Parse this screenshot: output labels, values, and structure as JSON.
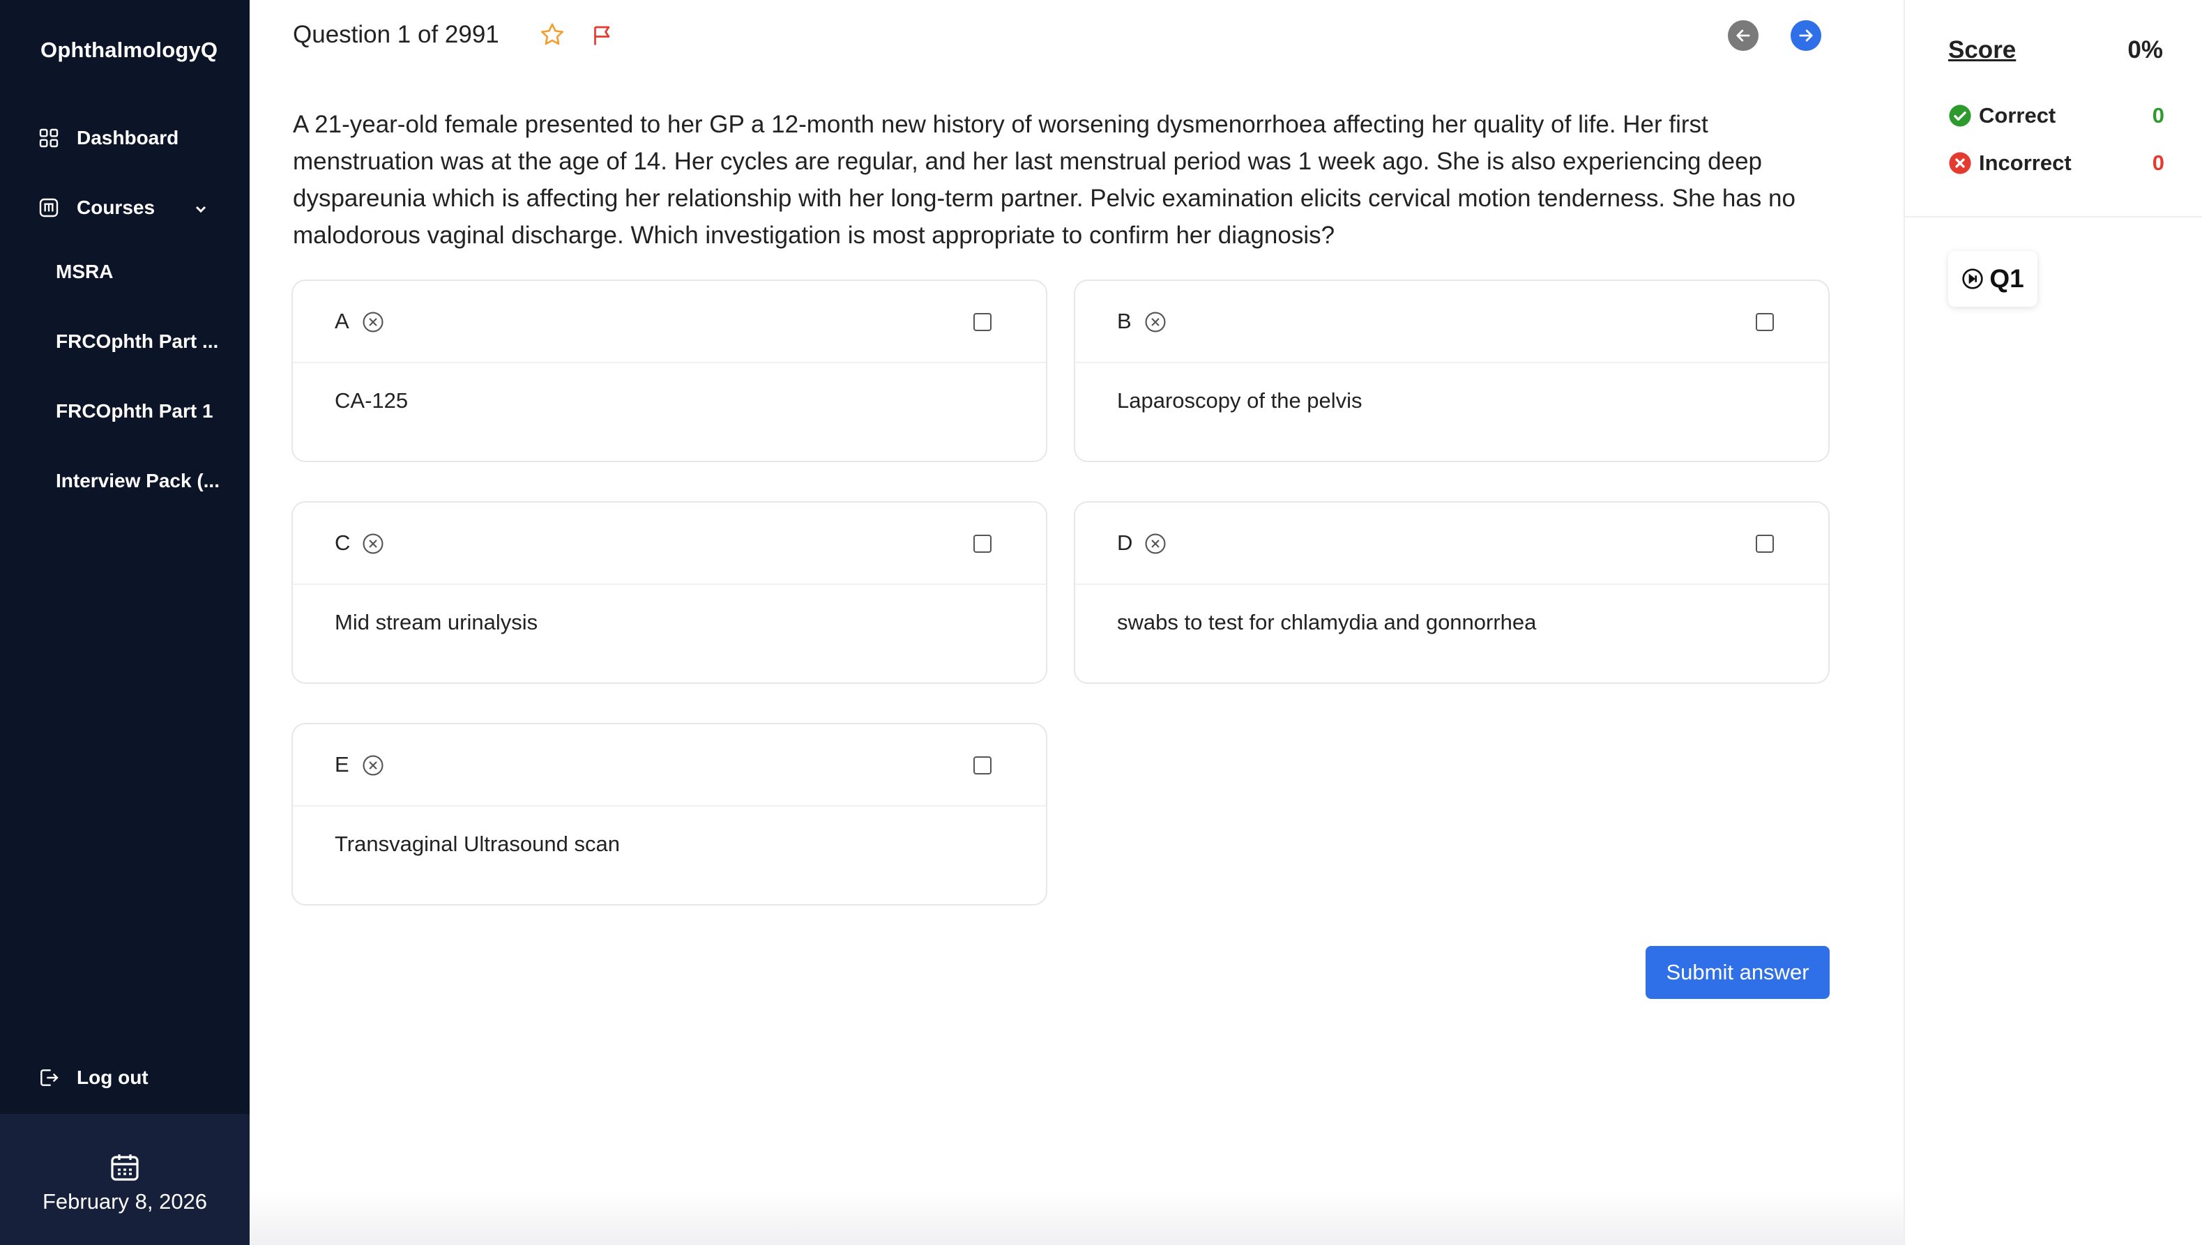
{
  "sidebar": {
    "brand": "OphthalmologyQ",
    "dashboard_label": "Dashboard",
    "courses_label": "Courses",
    "courses": [
      {
        "label": "MSRA"
      },
      {
        "label": "FRCOphth Part ..."
      },
      {
        "label": "FRCOphth Part 1"
      },
      {
        "label": "Interview Pack (..."
      }
    ],
    "logout_label": "Log out",
    "date": "February 8, 2026"
  },
  "header": {
    "question_counter": "Question 1 of 2991"
  },
  "question": {
    "text": "A 21-year-old female presented to her GP a 12-month new history of worsening dysmenorrhoea affecting her quality of life. Her first menstruation was at the age of 14. Her cycles are regular, and her last menstrual period was 1 week ago. She is also experiencing deep dyspareunia which is affecting her relationship with her long-term partner. Pelvic examination elicits cervical motion tenderness. She has no malodorous vaginal discharge. Which investigation is most appropriate to confirm her diagnosis?",
    "options": [
      {
        "letter": "A",
        "text": "CA-125"
      },
      {
        "letter": "B",
        "text": "Laparoscopy of the pelvis"
      },
      {
        "letter": "C",
        "text": "Mid stream urinalysis"
      },
      {
        "letter": "D",
        "text": "swabs to test for chlamydia and gonnorrhea"
      },
      {
        "letter": "E",
        "text": "Transvaginal Ultrasound scan"
      }
    ],
    "submit_label": "Submit answer"
  },
  "score_panel": {
    "score_label": "Score",
    "score_value": "0%",
    "correct_label": "Correct",
    "correct_value": "0",
    "incorrect_label": "Incorrect",
    "incorrect_value": "0",
    "question_chip": "Q1"
  },
  "colors": {
    "sidebar_bg": "#0c1428",
    "accent_blue": "#2f6fe8",
    "star": "#f0a030",
    "flag": "#e53a2f",
    "correct_green": "#2e9a2e",
    "incorrect_red": "#e53a2f"
  }
}
